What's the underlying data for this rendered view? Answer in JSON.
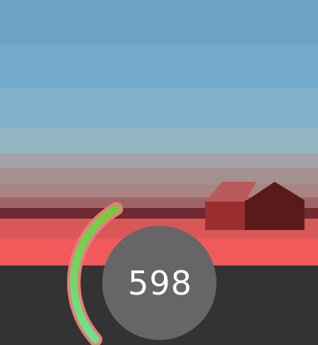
{
  "hud": {
    "score": "598",
    "boost_level": 0.62
  },
  "scene": {
    "barn": {
      "front_color": "#9b2f2f",
      "side_color": "#5a1a1a",
      "roof_color": "#b85a5a"
    }
  },
  "colors": {
    "ground": "#333333",
    "score_circle": "#666666",
    "gauge_outline": "#e87d7d",
    "gauge_fill_start": "#6ee38f",
    "gauge_fill_end": "#79c83a"
  }
}
